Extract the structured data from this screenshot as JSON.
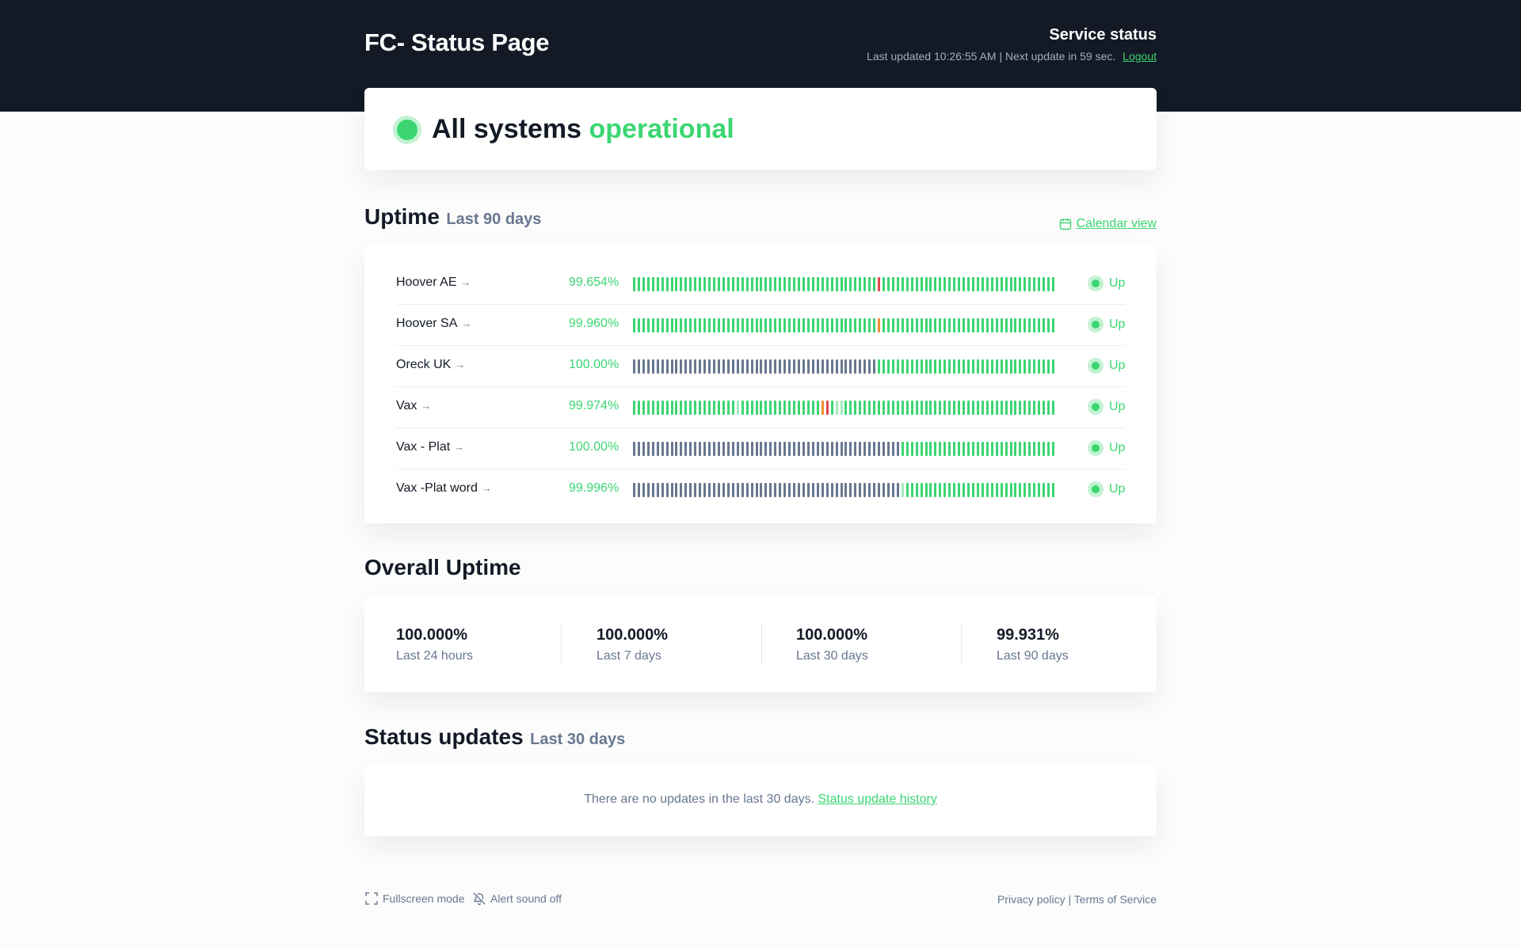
{
  "header": {
    "title": "FC- Status Page",
    "service_status": "Service status",
    "last_updated": "Last updated 10:26:55 AM | Next update in 59 sec.",
    "logout": "Logout"
  },
  "overall_status": {
    "prefix": "All systems",
    "state": "operational"
  },
  "uptime": {
    "title": "Uptime",
    "period": "Last 90 days",
    "calendar_link": "Calendar view",
    "colors": {
      "up": "#3bd671",
      "no_data": "#687790",
      "light": "#a6e9bd",
      "degraded": "#f29030",
      "down": "#df484a"
    },
    "monitors": [
      {
        "name": "Hoover AE",
        "uptime": "99.654%",
        "status": "Up",
        "days": "GGGGGGGGGGGGGGGGGGGGGGGGGGGGGGGGGGGGGGGGGGGGGGGGGGGGRGGGGGGGGGGGGGGGGGGGGGGGGGGGGGGGGGGGGG"
      },
      {
        "name": "Hoover SA",
        "uptime": "99.960%",
        "status": "Up",
        "days": "GGGGGGGGGGGGGGGGGGGGGGGGGGGGGGGGGGGGGGGGGGGGGGGGGGGGOGGGGGGGGGGGGGGGGGGGGGGGGGGGGGGGGGGGGG"
      },
      {
        "name": "Oreck UK",
        "uptime": "100.00%",
        "status": "Up",
        "days": "NNNNNNNNNNNNNNNNNNNNNNNNNNNNNNNNNNNNNNNNNNNNNNNNNNNNGGGGGGGGGGGGGGGGGGGGGGGGGGGGGGGGGGGGGG"
      },
      {
        "name": "Vax",
        "uptime": "99.974%",
        "status": "Up",
        "days": "GGGGGGGGGGGGGGGGGGGGGGLGGGGGGGGGGGGGGGGGORGLLGGGGGGGGGGGGGGGGGGGGGGGGGGGGGGGGGGGGGGGGGGGGG"
      },
      {
        "name": "Vax - Plat",
        "uptime": "100.00%",
        "status": "Up",
        "days": "NNNNNNNNNNNNNNNNNNNNNNNNNNNNNNNNNNNNNNNNNNNNNNNNNNNNNNNNNGGGGGGGGGGGGGGGGGGGGGGGGGGGGGGGGG"
      },
      {
        "name": "Vax -Plat word",
        "uptime": "99.996%",
        "status": "Up",
        "days": "NNNNNNNNNNNNNNNNNNNNNNNNNNNNNNNNNNNNNNNNNNNNNNNNNNNNNNNNNLGGGGGGGGGGGGGGGGGGGGGGGGGGGGGGGG"
      }
    ]
  },
  "overall_uptime": {
    "title": "Overall Uptime",
    "stats": [
      {
        "value": "100.000%",
        "label": "Last 24 hours"
      },
      {
        "value": "100.000%",
        "label": "Last 7 days"
      },
      {
        "value": "100.000%",
        "label": "Last 30 days"
      },
      {
        "value": "99.931%",
        "label": "Last 90 days"
      }
    ]
  },
  "status_updates": {
    "title": "Status updates",
    "period": "Last 30 days",
    "empty_text": "There are no updates in the last 30 days.",
    "history_link": "Status update history"
  },
  "footer": {
    "fullscreen": "Fullscreen mode",
    "alert_sound": "Alert sound off",
    "privacy": "Privacy policy",
    "separator": "|",
    "terms": "Terms of Service"
  }
}
